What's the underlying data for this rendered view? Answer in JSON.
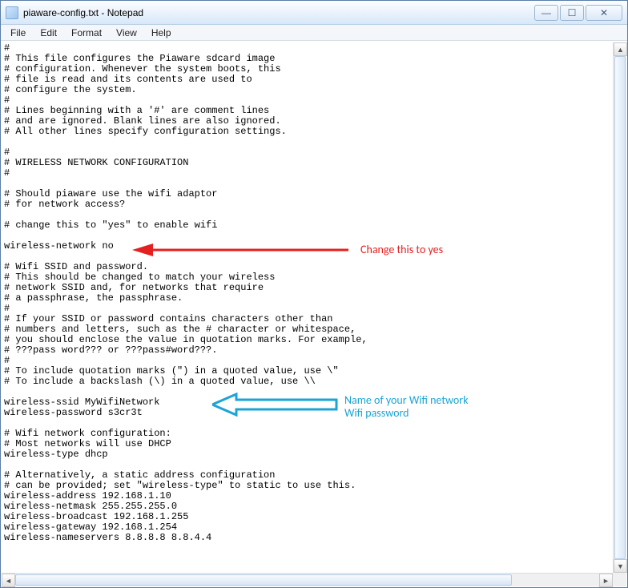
{
  "window": {
    "title": "piaware-config.txt - Notepad"
  },
  "menu": {
    "file": "File",
    "edit": "Edit",
    "format": "Format",
    "view": "View",
    "help": "Help"
  },
  "content": "#\n# This file configures the Piaware sdcard image\n# configuration. Whenever the system boots, this\n# file is read and its contents are used to\n# configure the system.\n#\n# Lines beginning with a '#' are comment lines\n# and are ignored. Blank lines are also ignored.\n# All other lines specify configuration settings.\n\n#\n# WIRELESS NETWORK CONFIGURATION\n#\n\n# Should piaware use the wifi adaptor\n# for network access?\n\n# change this to \"yes\" to enable wifi\n\nwireless-network no\n\n# Wifi SSID and password.\n# This should be changed to match your wireless\n# network SSID and, for networks that require\n# a passphrase, the passphrase.\n#\n# If your SSID or password contains characters other than\n# numbers and letters, such as the # character or whitespace,\n# you should enclose the value in quotation marks. For example,\n# ???pass word??? or ???pass#word???.\n#\n# To include quotation marks (\") in a quoted value, use \\\"\n# To include a backslash (\\) in a quoted value, use \\\\\n\nwireless-ssid MyWifiNetwork\nwireless-password s3cr3t\n\n# Wifi network configuration:\n# Most networks will use DHCP\nwireless-type dhcp\n\n# Alternatively, a static address configuration\n# can be provided; set \"wireless-type\" to static to use this.\nwireless-address 192.168.1.10\nwireless-netmask 255.255.255.0\nwireless-broadcast 192.168.1.255\nwireless-gateway 192.168.1.254\nwireless-nameservers 8.8.8.8 8.8.4.4\n",
  "annotations": {
    "red_label": "Change this to yes",
    "blue_line1": "Name of your Wifi network",
    "blue_line2": "Wifi password"
  },
  "buttons": {
    "min": "—",
    "max": "☐",
    "close": "✕"
  }
}
